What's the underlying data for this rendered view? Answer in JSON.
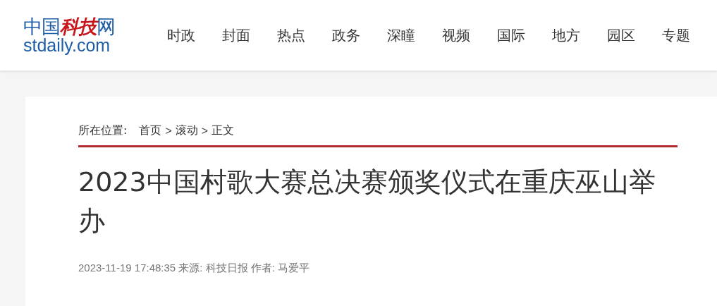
{
  "logo": {
    "parts": [
      {
        "text": "中国",
        "kind": "plain"
      },
      {
        "text": "科技",
        "kind": "accent"
      },
      {
        "text": "网",
        "kind": "plain"
      }
    ],
    "domain": "stdaily.com"
  },
  "nav": [
    {
      "label": "时政"
    },
    {
      "label": "封面"
    },
    {
      "label": "热点"
    },
    {
      "label": "政务"
    },
    {
      "label": "深瞳"
    },
    {
      "label": "视频"
    },
    {
      "label": "国际"
    },
    {
      "label": "地方"
    },
    {
      "label": "园区"
    },
    {
      "label": "专题"
    }
  ],
  "breadcrumb": {
    "label": "所在位置:",
    "items": [
      {
        "text": "首页",
        "kind": "link"
      },
      {
        "text": ">",
        "kind": "sep"
      },
      {
        "text": "滚动",
        "kind": "link"
      },
      {
        "text": ">",
        "kind": "sep"
      },
      {
        "text": "正文",
        "kind": "link"
      }
    ]
  },
  "article": {
    "title": "2023中国村歌大赛总决赛颁奖仪式在重庆巫山举办",
    "meta": "2023-11-19 17:48:35 来源: 科技日报 作者: 马爱平"
  }
}
